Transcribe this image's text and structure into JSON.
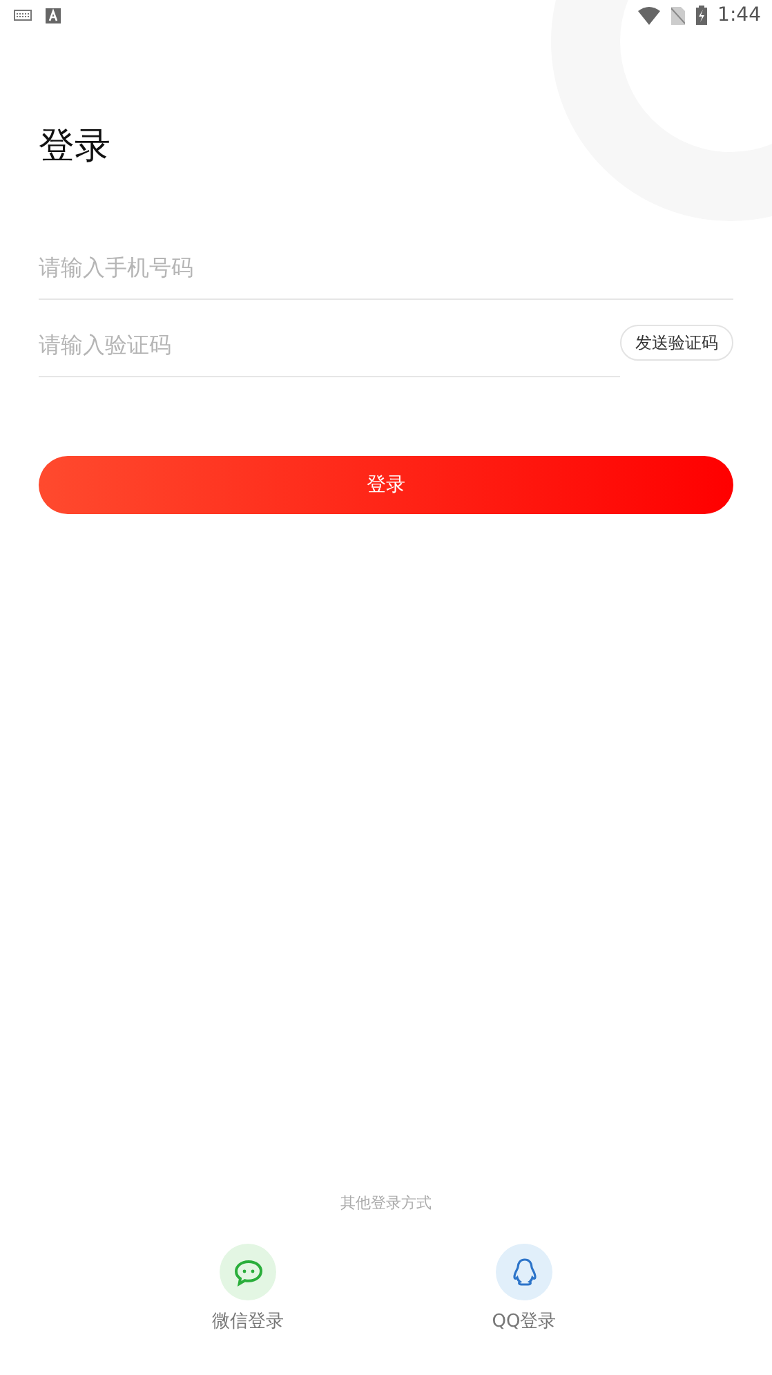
{
  "status_bar": {
    "time": "1:44"
  },
  "title": "登录",
  "phone_field": {
    "placeholder": "请输入手机号码"
  },
  "code_field": {
    "placeholder": "请输入验证码"
  },
  "send_code_button": "发送验证码",
  "login_button": "登录",
  "other_login": {
    "label": "其他登录方式",
    "options": [
      {
        "kind": "wechat",
        "label": "微信登录"
      },
      {
        "kind": "qq",
        "label": "QQ登录"
      }
    ]
  }
}
